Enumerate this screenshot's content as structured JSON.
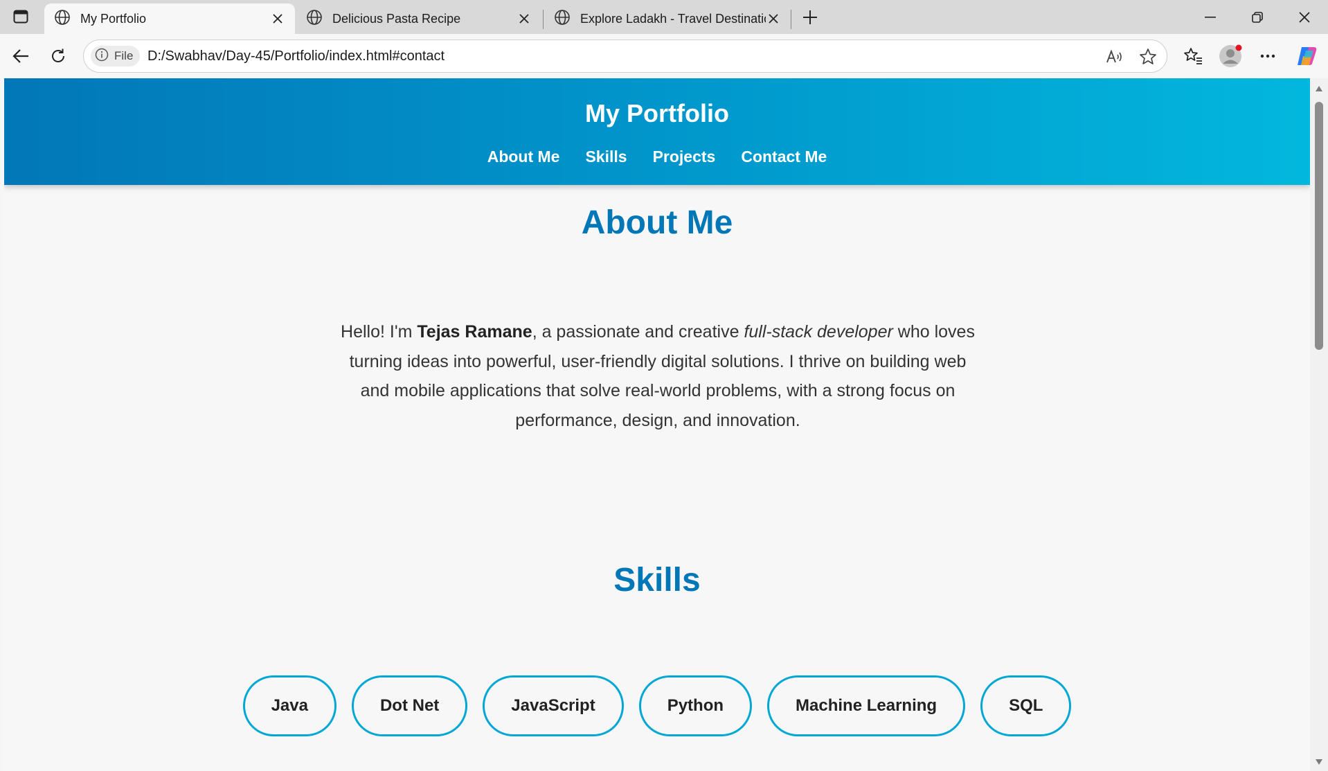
{
  "browser": {
    "tabs": [
      {
        "title": "My Portfolio",
        "icon": "globe-icon",
        "active": true
      },
      {
        "title": "Delicious Pasta Recipe",
        "icon": "globe-icon",
        "active": false
      },
      {
        "title": "Explore Ladakh - Travel Destinatio",
        "icon": "globe-icon",
        "active": false
      }
    ],
    "address": {
      "security_label": "File",
      "url": "D:/Swabhav/Day-45/Portfolio/index.html#contact"
    }
  },
  "page": {
    "header": {
      "title": "My Portfolio",
      "nav": [
        "About Me",
        "Skills",
        "Projects",
        "Contact Me"
      ]
    },
    "about": {
      "heading": "About Me",
      "intro": "Hello! I'm ",
      "name": "Tejas Ramane",
      "mid": ", a passionate and creative ",
      "role": "full-stack developer",
      "rest": " who loves turning ideas into powerful, user-friendly digital solutions. I thrive on building web and mobile applications that solve real-world problems, with a strong focus on performance, design, and innovation."
    },
    "skills": {
      "heading": "Skills",
      "items": [
        "Java",
        "Dot Net",
        "JavaScript",
        "Python",
        "Machine Learning",
        "SQL"
      ]
    }
  },
  "colors": {
    "header_gradient_start": "#0277b8",
    "header_gradient_end": "#02b7dd",
    "heading": "#0277b8",
    "pill_border": "#02a7d4"
  }
}
